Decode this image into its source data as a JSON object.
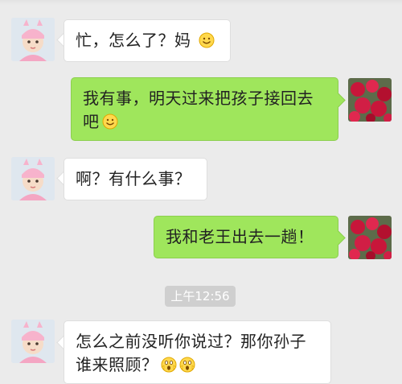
{
  "chat": {
    "messages": [
      {
        "sender": "contact",
        "text": "忙，怎么了？妈",
        "emoji": "smile-emoji"
      },
      {
        "sender": "me",
        "line1": "我有事，明天过来把孩子接回去",
        "line2": "吧",
        "emoji": "smile-emoji"
      },
      {
        "sender": "contact",
        "text": "啊？有什么事？"
      },
      {
        "sender": "me",
        "text": "我和老王出去一趟！"
      },
      {
        "sender": "contact",
        "line1": "怎么之前没听你说过？那你孙子",
        "line2": "谁来照顾？",
        "emoji": "shocked-emoji"
      }
    ],
    "timestamp": "上午12:56"
  },
  "colors": {
    "background": "#ebebeb",
    "incoming_bubble": "#ffffff",
    "outgoing_bubble": "#9fe65c",
    "time_badge": "#cfcfcf"
  }
}
